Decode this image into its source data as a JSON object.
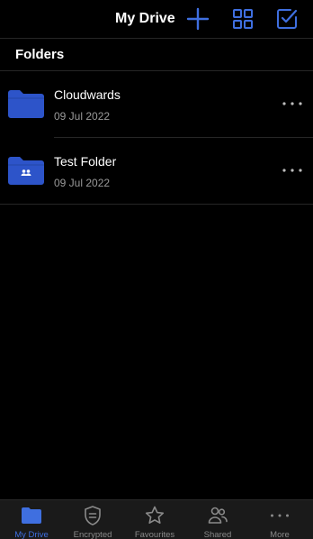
{
  "header": {
    "title": "My Drive",
    "add_icon": "plus-icon",
    "grid_icon": "grid-view-icon",
    "select_icon": "checkbox-select-icon"
  },
  "section": {
    "title": "Folders"
  },
  "folders": [
    {
      "name": "Cloudwards",
      "date": "09 Jul 2022",
      "icon": "folder-icon",
      "shared": false
    },
    {
      "name": "Test Folder",
      "date": "09 Jul 2022",
      "icon": "shared-folder-icon",
      "shared": true
    }
  ],
  "tabs": [
    {
      "label": "My Drive",
      "icon": "folder-icon",
      "active": true
    },
    {
      "label": "Encrypted",
      "icon": "shield-icon",
      "active": false
    },
    {
      "label": "Favourites",
      "icon": "star-icon",
      "active": false
    },
    {
      "label": "Shared",
      "icon": "users-icon",
      "active": false
    },
    {
      "label": "More",
      "icon": "more-dots-icon",
      "active": false
    }
  ],
  "colors": {
    "accent": "#3f6fe0",
    "folder": "#2d54c9",
    "background": "#000000",
    "tabbar": "#1a1a1a",
    "secondary_text": "#9a9a9a"
  }
}
